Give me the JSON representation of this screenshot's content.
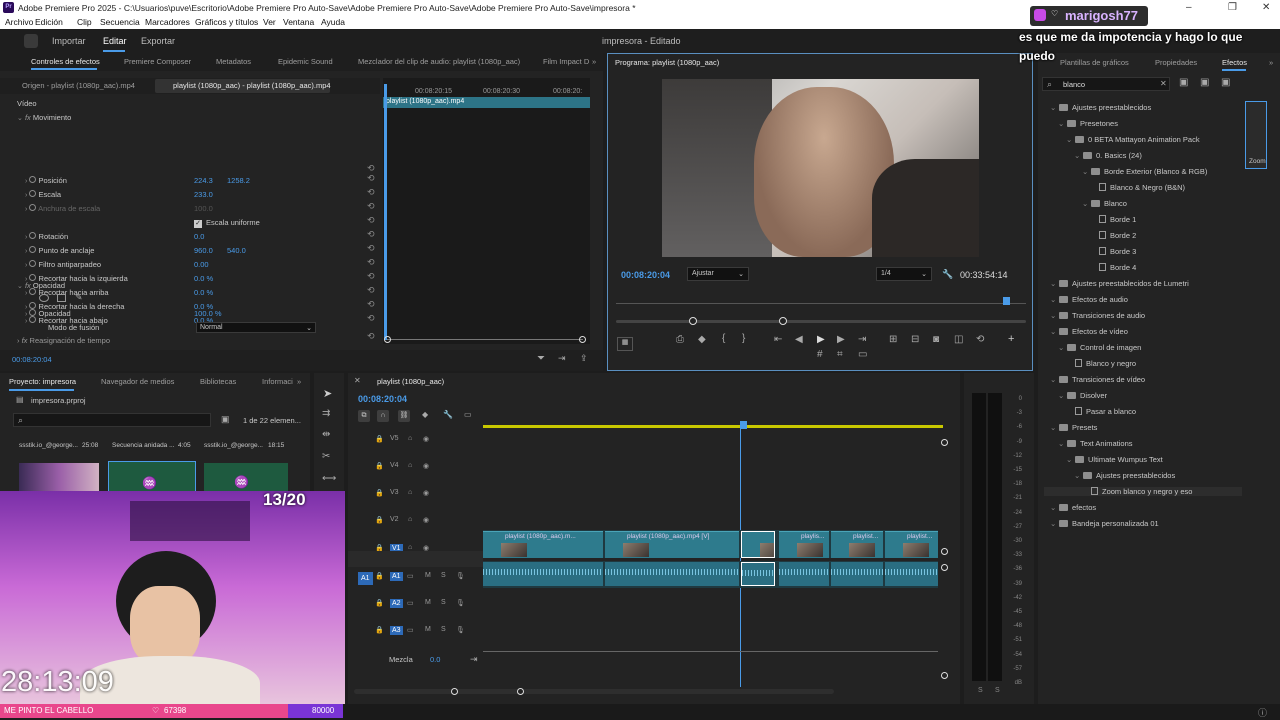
{
  "app": {
    "title": "Adobe Premiere Pro 2025 - C:\\Usuarios\\puve\\Escritorio\\Adobe Premiere Pro Auto-Save\\Adobe Premiere Pro Auto-Save\\Adobe Premiere Pro Auto-Save\\impresora *",
    "icon": "Pr"
  },
  "menu": [
    "Archivo",
    "Edición",
    "Clip",
    "Secuencia",
    "Marcadores",
    "Gráficos y títulos",
    "Ver",
    "Ventana",
    "Ayuda"
  ],
  "workspace": {
    "tabs": [
      "Importar",
      "Editar",
      "Exportar"
    ],
    "active": "Editar",
    "project_title": "impresora - Editado"
  },
  "effect_controls": {
    "tabs": [
      "Controles de efectos",
      "Premiere Composer",
      "Metadatos",
      "Epidemic Sound",
      "Mezclador del clip de audio: playlist (1080p_aac)",
      "Film Impact D"
    ],
    "source_tabs": [
      "Origen - playlist (1080p_aac).mp4",
      "playlist (1080p_aac) - playlist (1080p_aac).mp4"
    ],
    "video_label": "Vídeo",
    "motion": "Movimiento",
    "props": [
      {
        "name": "Posición",
        "v1": "224.3",
        "v2": "1258.2"
      },
      {
        "name": "Escala",
        "v1": "233.0",
        "v2": ""
      },
      {
        "name": "Anchura de escala",
        "v1": "100.0",
        "v2": ""
      },
      {
        "name": "Escala uniforme",
        "v1": "",
        "v2": ""
      },
      {
        "name": "Rotación",
        "v1": "0.0",
        "v2": ""
      },
      {
        "name": "Punto de anclaje",
        "v1": "960.0",
        "v2": "540.0"
      },
      {
        "name": "Filtro antiparpadeo",
        "v1": "0.00",
        "v2": ""
      },
      {
        "name": "Recortar hacia la izquierda",
        "v1": "0.0 %",
        "v2": ""
      },
      {
        "name": "Recortar hacia arriba",
        "v1": "0.0 %",
        "v2": ""
      },
      {
        "name": "Recortar hacia la derecha",
        "v1": "0.0 %",
        "v2": ""
      },
      {
        "name": "Recortar hacia abajo",
        "v1": "0.0 %",
        "v2": ""
      }
    ],
    "opacity_section": "Opacidad",
    "opacity_label": "Opacidad",
    "opacity_value": "100.0 %",
    "blend_label": "Modo de fusión",
    "blend_value": "Normal",
    "remap": "Reasignación de tiempo",
    "timecode": "00:08:20:04",
    "mini_ruler": [
      "00:08:20:15",
      "00:08:20:30",
      "00:08:20:"
    ],
    "mini_clip": "playlist (1080p_aac).mp4"
  },
  "program": {
    "tab": "Programa: playlist (1080p_aac)",
    "timecode": "00:08:20:04",
    "fit": "Ajustar",
    "quality": "1/4",
    "duration": "00:33:54:14"
  },
  "project": {
    "tabs": [
      "Proyecto: impresora",
      "Navegador de medios",
      "Bibliotecas",
      "Informaci"
    ],
    "file": "impresora.prproj",
    "count": "1 de 22 elemen...",
    "items": [
      {
        "name": "ssstik.io_@george...",
        "dur": "25:08"
      },
      {
        "name": "Secuencia anidada ...",
        "dur": "4:05"
      },
      {
        "name": "ssstik.io_@george...",
        "dur": "18:15"
      }
    ]
  },
  "timeline": {
    "tab": "playlist (1080p_aac)",
    "timecode": "00:08:20:04",
    "tracks_v": [
      "V5",
      "V4",
      "V3",
      "V2",
      "V1"
    ],
    "tracks_a": [
      "A1",
      "A2",
      "A3"
    ],
    "mix_label": "Mezcla",
    "mix_value": "0.0",
    "clips": [
      "playlist (1080p_aac).m...",
      "playlist (1080p_aac).mp4 [V]",
      "playlis...",
      "playlist...",
      "playlist..."
    ],
    "meter_labels": [
      "0",
      "-3",
      "-6",
      "-9",
      "-12",
      "-15",
      "-18",
      "-21",
      "-24",
      "-27",
      "-30",
      "-33",
      "-36",
      "-39",
      "-42",
      "-45",
      "-48",
      "-51",
      "-54",
      "-57",
      "dB"
    ]
  },
  "effects": {
    "tabs": [
      "Plantillas de gráficos",
      "Propiedades",
      "Efectos"
    ],
    "search": "blanco",
    "preview": "Zoom",
    "tree": [
      {
        "t": "Ajustes preestablecidos",
        "d": 0,
        "k": "folder"
      },
      {
        "t": "Presetones",
        "d": 1,
        "k": "folder"
      },
      {
        "t": "0 BETA Mattayon Animation Pack",
        "d": 2,
        "k": "folder"
      },
      {
        "t": "0. Basics (24)",
        "d": 3,
        "k": "folder"
      },
      {
        "t": "Borde Exterior (Blanco & RGB)",
        "d": 4,
        "k": "folder"
      },
      {
        "t": "Blanco & Negro (B&N)",
        "d": 5,
        "k": "file"
      },
      {
        "t": "Blanco",
        "d": 4,
        "k": "folder"
      },
      {
        "t": "Borde 1",
        "d": 5,
        "k": "file"
      },
      {
        "t": "Borde 2",
        "d": 5,
        "k": "file"
      },
      {
        "t": "Borde 3",
        "d": 5,
        "k": "file"
      },
      {
        "t": "Borde 4",
        "d": 5,
        "k": "file"
      },
      {
        "t": "Ajustes preestablecidos de Lumetri",
        "d": 0,
        "k": "folder"
      },
      {
        "t": "Efectos de audio",
        "d": 0,
        "k": "folder"
      },
      {
        "t": "Transiciones de audio",
        "d": 0,
        "k": "folder"
      },
      {
        "t": "Efectos de vídeo",
        "d": 0,
        "k": "folder"
      },
      {
        "t": "Control de imagen",
        "d": 1,
        "k": "folder"
      },
      {
        "t": "Blanco y negro",
        "d": 2,
        "k": "file"
      },
      {
        "t": "Transiciones de vídeo",
        "d": 0,
        "k": "folder"
      },
      {
        "t": "Disolver",
        "d": 1,
        "k": "folder"
      },
      {
        "t": "Pasar a blanco",
        "d": 2,
        "k": "file"
      },
      {
        "t": "Presets",
        "d": 0,
        "k": "folder"
      },
      {
        "t": "Text Animations",
        "d": 1,
        "k": "folder"
      },
      {
        "t": "Ultimate Wumpus Text",
        "d": 2,
        "k": "folder"
      },
      {
        "t": "Ajustes preestablecidos",
        "d": 3,
        "k": "folder"
      },
      {
        "t": "Zoom blanco y negro y eso",
        "d": 4,
        "k": "file"
      },
      {
        "t": "efectos",
        "d": 0,
        "k": "folder"
      },
      {
        "t": "Bandeja personalizada 01",
        "d": 0,
        "k": "folder"
      }
    ]
  },
  "overlay": {
    "chat_user": "marigosh77",
    "chat_msg": "es que me da impotencia y hago lo que puedo",
    "goal": "13/20",
    "clock": "28:13:09",
    "ticker_left": "ME PINTO EL CABELLO",
    "ticker_mid": "67398",
    "ticker_right": "80000"
  }
}
